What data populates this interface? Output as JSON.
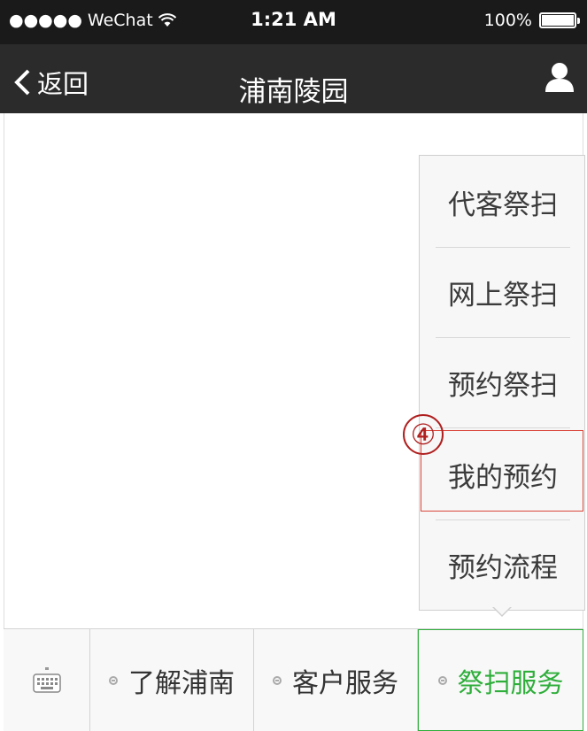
{
  "status_bar": {
    "carrier": "●●●●● WeChat",
    "time": "1:21 AM",
    "battery": "100%"
  },
  "nav": {
    "back_label": "返回",
    "title": "浦南陵园"
  },
  "popup_menu": {
    "items": [
      "代客祭扫",
      "网上祭扫",
      "预约祭扫",
      "我的预约",
      "预约流程"
    ],
    "highlighted_index": 3,
    "step_marker": "④",
    "highlight_color": "#d9453a"
  },
  "bottom_menu": {
    "items": [
      "了解浦南",
      "客户服务",
      "祭扫服务"
    ],
    "active_index": 2,
    "active_color": "#2fae3b"
  },
  "icons": {
    "back": "chevron-left-icon",
    "user": "user-icon",
    "wifi": "wifi-icon",
    "battery": "battery-icon",
    "keyboard": "keyboard-icon",
    "menu_dot": "menu-dot-icon"
  }
}
